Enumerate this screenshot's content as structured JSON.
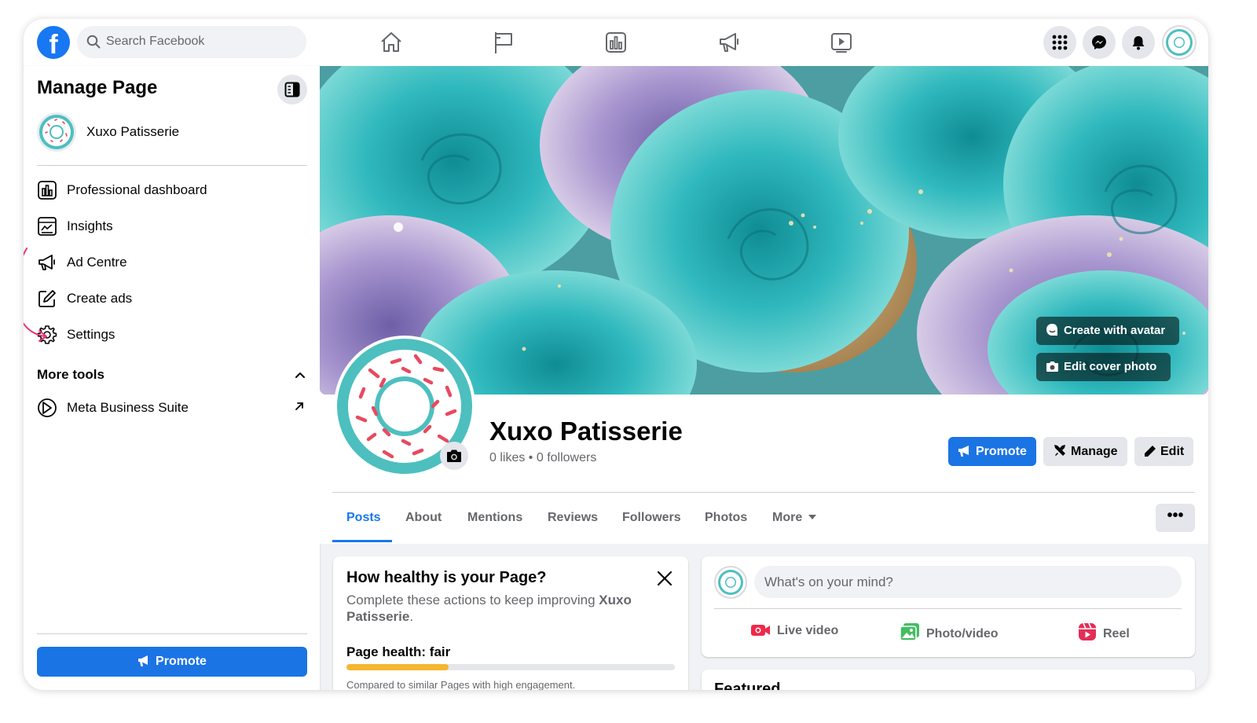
{
  "topbar": {
    "logo": "facebook-logo",
    "search_placeholder": "Search Facebook",
    "nav_icons": [
      "home-icon",
      "flag-icon",
      "dashboard-icon",
      "megaphone-icon",
      "video-icon"
    ],
    "right_icons": [
      "menu-grid-icon",
      "messenger-icon",
      "bell-icon"
    ]
  },
  "sidebar": {
    "title": "Manage Page",
    "page_name": "Xuxo Patisserie",
    "items": [
      {
        "label": "Professional dashboard",
        "icon": "dashboard-icon"
      },
      {
        "label": "Insights",
        "icon": "insights-icon"
      },
      {
        "label": "Ad Centre",
        "icon": "megaphone-icon"
      },
      {
        "label": "Create ads",
        "icon": "edit-icon"
      },
      {
        "label": "Settings",
        "icon": "gear-icon"
      }
    ],
    "more_tools_label": "More tools",
    "tools": [
      {
        "label": "Meta Business Suite",
        "icon": "meta-business-icon"
      }
    ],
    "promote_label": "Promote"
  },
  "cover": {
    "create_avatar_label": "Create with avatar",
    "edit_cover_label": "Edit cover photo"
  },
  "profile": {
    "name": "Xuxo Patisserie",
    "stats": "0 likes • 0 followers",
    "promote_label": "Promote",
    "manage_label": "Manage",
    "edit_label": "Edit"
  },
  "tabs": {
    "items": [
      "Posts",
      "About",
      "Mentions",
      "Reviews",
      "Followers",
      "Photos"
    ],
    "more_label": "More",
    "active": "Posts",
    "options_label": "•••"
  },
  "health": {
    "title": "How healthy is your Page?",
    "desc_prefix": "Complete these actions to keep improving ",
    "desc_name": "Xuxo Patisserie",
    "desc_suffix": ".",
    "status": "Page health: fair",
    "progress": 0.31,
    "note": "Compared to similar Pages with high engagement."
  },
  "composer": {
    "placeholder": "What's on your mind?",
    "actions": [
      "Live video",
      "Photo/video",
      "Reel"
    ]
  },
  "featured": {
    "title": "Featured"
  },
  "colors": {
    "brand": "#1877f2",
    "button_blue": "#1b74e4",
    "donut_teal": "#4dbfbf",
    "health_bar": "#f5b731",
    "annotation": "#e8336d"
  }
}
